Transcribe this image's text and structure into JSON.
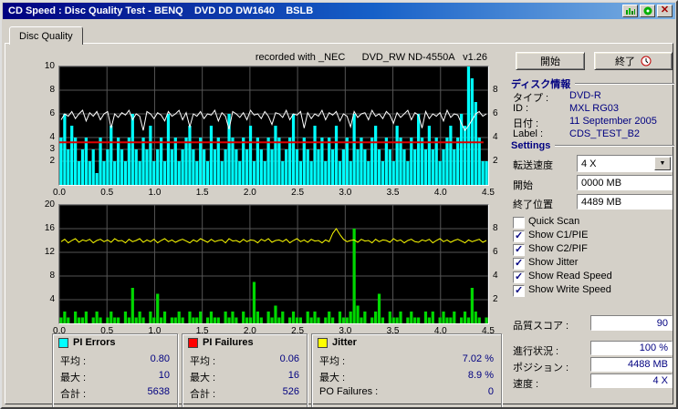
{
  "window": {
    "title": "CD Speed : Disc Quality Test - BENQ    DVD DD DW1640    BSLB"
  },
  "tab": {
    "label": "Disc Quality"
  },
  "recorded_label": "recorded with _NEC      DVD_RW ND-4550A   v1.26",
  "buttons": {
    "start": "開始",
    "exit": "終了"
  },
  "disc_info": {
    "header": "ディスク情報",
    "rows": [
      {
        "label": "タイプ :",
        "value": "DVD-R"
      },
      {
        "label": "ID :",
        "value": "MXL RG03"
      },
      {
        "label": "日付 :",
        "value": "11 September 2005"
      },
      {
        "label": "Label :",
        "value": "CDS_TEST_B2"
      }
    ]
  },
  "settings": {
    "header": "Settings",
    "speed_label": "転送速度",
    "speed_value": "4 X",
    "start_label": "開始",
    "start_value": "0000 MB",
    "end_label": "終了位置",
    "end_value": "4489 MB",
    "checkboxes": [
      {
        "label": "Quick Scan",
        "checked": false
      },
      {
        "label": "Show C1/PIE",
        "checked": true
      },
      {
        "label": "Show C2/PIF",
        "checked": true
      },
      {
        "label": "Show Jitter",
        "checked": true
      },
      {
        "label": "Show Read Speed",
        "checked": true
      },
      {
        "label": "Show Write Speed",
        "checked": true
      }
    ]
  },
  "quality": {
    "label": "品質スコア :",
    "value": "90"
  },
  "progress": {
    "rows": [
      {
        "label": "進行状況 :",
        "value": "100 %"
      },
      {
        "label": "ポジション :",
        "value": "4488 MB"
      },
      {
        "label": "速度 :",
        "value": "4 X"
      }
    ]
  },
  "stats": {
    "pi_errors": {
      "title": "PI Errors",
      "color": "#00ffff",
      "rows": [
        {
          "label": "平均 :",
          "value": "0.80"
        },
        {
          "label": "最大 :",
          "value": "10"
        },
        {
          "label": "合計 :",
          "value": "5638"
        }
      ]
    },
    "pi_failures": {
      "title": "PI Failures",
      "color": "#ff0000",
      "rows": [
        {
          "label": "平均 :",
          "value": "0.06"
        },
        {
          "label": "最大 :",
          "value": "16"
        },
        {
          "label": "合計 :",
          "value": "526"
        }
      ]
    },
    "jitter": {
      "title": "Jitter",
      "color": "#ffff00",
      "rows": [
        {
          "label": "平均 :",
          "value": "7.02 %"
        },
        {
          "label": "最大 :",
          "value": "8.9 %"
        },
        {
          "label": "PO Failures :",
          "value": "0"
        }
      ]
    }
  },
  "chart_data": [
    {
      "name": "pi-errors",
      "type": "bar",
      "x_range": [
        0,
        4.5
      ],
      "y_range": [
        0,
        10
      ],
      "x_ticks": [
        {
          "label": "0.0",
          "at": 0
        },
        {
          "label": "0.5",
          "at": 0.5
        },
        {
          "label": "1.0",
          "at": 1
        },
        {
          "label": "1.5",
          "at": 1.5
        },
        {
          "label": "2.0",
          "at": 2
        },
        {
          "label": "2.5",
          "at": 2.5
        },
        {
          "label": "3.0",
          "at": 3
        },
        {
          "label": "3.5",
          "at": 3.5
        },
        {
          "label": "4.0",
          "at": 4
        },
        {
          "label": "4.5",
          "at": 4.5
        }
      ],
      "y_ticks_left": [
        {
          "label": "10",
          "at": 10
        },
        {
          "label": "8",
          "at": 8
        },
        {
          "label": "6",
          "at": 6
        },
        {
          "label": "4",
          "at": 4
        },
        {
          "label": "3",
          "at": 3
        },
        {
          "label": "2",
          "at": 2
        }
      ],
      "y_ticks_right": [
        {
          "label": "8",
          "at": 8
        },
        {
          "label": "6",
          "at": 6
        },
        {
          "label": "4",
          "at": 4
        },
        {
          "label": "2",
          "at": 2
        }
      ],
      "series": [
        {
          "name": "PI Errors",
          "kind": "bar",
          "color": "#00ffff",
          "values": [
            4,
            6,
            3,
            5,
            4,
            2,
            3,
            4,
            2,
            3,
            1,
            4,
            2,
            3,
            5,
            2,
            4,
            3,
            2,
            4,
            6,
            3,
            2,
            4,
            3,
            5,
            2,
            3,
            4,
            2,
            6,
            3,
            4,
            2,
            3,
            4,
            5,
            3,
            2,
            4,
            3,
            2,
            5,
            3,
            4,
            2,
            3,
            6,
            4,
            3,
            2,
            4,
            3,
            5,
            2,
            4,
            3,
            2,
            4,
            3,
            5,
            4,
            2,
            3,
            4,
            6,
            3,
            2,
            4,
            3,
            2,
            5,
            3,
            4,
            2,
            4,
            3,
            5,
            2,
            3,
            4,
            2,
            6,
            3,
            4,
            3,
            2,
            4,
            5,
            3,
            2,
            4,
            3,
            2,
            5,
            4,
            3,
            2,
            4,
            3,
            6,
            4,
            3,
            5,
            3,
            4,
            2,
            3,
            4,
            5,
            3,
            4,
            6,
            5,
            10,
            9,
            7,
            4,
            2,
            2
          ]
        },
        {
          "name": "Read Speed",
          "kind": "line",
          "color": "#ffffff",
          "values": [
            5.5,
            6.0,
            5.8,
            6.2,
            5.6,
            6.0,
            6.3,
            5.4,
            6.1,
            5.8,
            6.2,
            5.5,
            6.0,
            6.2,
            4.8,
            6.0,
            5.7,
            6.1,
            5.9,
            6.3,
            5.5,
            6.0,
            5.8,
            4.6,
            6.2,
            6.0,
            5.6,
            6.1,
            5.9,
            5.4,
            6.2,
            5.8,
            6.0,
            6.3,
            5.5,
            6.1,
            4.9,
            6.0,
            5.8,
            6.2,
            5.6,
            6.0,
            5.9,
            6.3,
            5.4,
            6.1,
            5.8,
            4.7,
            6.2,
            6.0,
            5.7,
            6.1,
            5.5,
            6.3,
            5.9,
            6.0,
            5.6,
            6.2,
            5.8,
            5.1,
            6.1,
            6.0,
            5.7,
            6.3,
            5.5,
            6.0,
            5.9,
            6.2,
            4.8,
            6.1,
            5.6,
            6.0,
            5.8,
            6.3,
            5.5,
            6.1,
            5.9,
            6.2,
            5.4,
            6.0,
            5.8,
            4.9,
            6.2,
            5.7,
            6.0,
            6.1,
            5.5,
            6.3,
            5.8,
            6.0,
            5.6,
            6.2,
            5.9,
            5.2,
            6.1,
            5.7,
            6.0,
            6.3,
            5.5,
            6.1,
            5.9,
            4.8,
            6.2,
            5.6,
            6.0,
            5.8,
            6.1,
            5.4,
            6.3,
            5.7,
            6.0,
            5.9,
            5.2,
            4.6,
            5.0,
            5.5,
            6.0,
            6.2,
            5.8,
            6.0
          ]
        },
        {
          "name": "Write Speed",
          "kind": "hline",
          "color": "#e00000",
          "value": 3.6,
          "x_end": 4.45
        }
      ]
    },
    {
      "name": "pi-failures-jitter",
      "type": "bar",
      "x_range": [
        0,
        4.5
      ],
      "y_range": [
        0,
        20
      ],
      "x_ticks": [
        {
          "label": "0.0",
          "at": 0
        },
        {
          "label": "0.5",
          "at": 0.5
        },
        {
          "label": "1.0",
          "at": 1
        },
        {
          "label": "1.5",
          "at": 1.5
        },
        {
          "label": "2.0",
          "at": 2
        },
        {
          "label": "2.5",
          "at": 2.5
        },
        {
          "label": "3.0",
          "at": 3
        },
        {
          "label": "3.5",
          "at": 3.5
        },
        {
          "label": "4.0",
          "at": 4
        },
        {
          "label": "4.5",
          "at": 4.5
        }
      ],
      "y_ticks_left": [
        {
          "label": "20",
          "at": 20
        },
        {
          "label": "16",
          "at": 16
        },
        {
          "label": "12",
          "at": 12
        },
        {
          "label": "8",
          "at": 8
        },
        {
          "label": "4",
          "at": 4
        }
      ],
      "y_ticks_right": [
        {
          "label": "8",
          "at": 16
        },
        {
          "label": "6",
          "at": 12
        },
        {
          "label": "4",
          "at": 8
        },
        {
          "label": "2",
          "at": 4
        }
      ],
      "series": [
        {
          "name": "PI Failures",
          "kind": "bar",
          "color": "#00d800",
          "values": [
            1,
            2,
            1,
            0,
            2,
            1,
            1,
            2,
            0,
            1,
            2,
            1,
            0,
            1,
            2,
            1,
            1,
            0,
            2,
            1,
            6,
            1,
            2,
            1,
            0,
            2,
            1,
            5,
            1,
            2,
            0,
            1,
            1,
            2,
            1,
            0,
            2,
            1,
            1,
            2,
            0,
            1,
            2,
            1,
            1,
            0,
            2,
            1,
            2,
            1,
            0,
            2,
            1,
            1,
            7,
            2,
            1,
            0,
            2,
            1,
            3,
            1,
            2,
            0,
            1,
            2,
            1,
            1,
            0,
            2,
            1,
            2,
            1,
            0,
            1,
            2,
            1,
            0,
            2,
            1,
            1,
            2,
            16,
            3,
            1,
            2,
            0,
            1,
            2,
            5,
            1,
            0,
            2,
            1,
            1,
            2,
            0,
            1,
            2,
            1,
            1,
            0,
            2,
            1,
            2,
            0,
            1,
            2,
            1,
            1,
            2,
            0,
            1,
            2,
            1,
            6,
            2,
            1,
            0,
            1
          ]
        },
        {
          "name": "Jitter",
          "kind": "line",
          "color": "#ffff00",
          "values": [
            13.8,
            14.2,
            13.6,
            14.0,
            14.3,
            13.7,
            14.1,
            13.9,
            14.2,
            13.6,
            14.0,
            14.2,
            13.8,
            14.1,
            13.7,
            14.3,
            13.9,
            14.0,
            13.6,
            14.2,
            13.8,
            14.0,
            14.3,
            13.7,
            14.1,
            13.8,
            14.2,
            13.6,
            14.0,
            14.3,
            13.8,
            14.1,
            13.7,
            14.0,
            14.2,
            13.9,
            13.6,
            14.1,
            13.8,
            14.3,
            14.0,
            13.7,
            14.2,
            13.8,
            14.0,
            14.1,
            13.6,
            14.3,
            13.9,
            14.0,
            13.7,
            14.2,
            13.8,
            14.1,
            14.0,
            13.6,
            14.2,
            13.9,
            14.3,
            13.7,
            14.0,
            14.1,
            13.8,
            14.2,
            13.6,
            14.0,
            14.3,
            13.8,
            14.1,
            13.7,
            14.2,
            13.9,
            14.0,
            13.6,
            14.1,
            13.8,
            15.2,
            16.0,
            15.0,
            14.2,
            13.8,
            14.0,
            14.1,
            13.7,
            14.2,
            13.9,
            14.0,
            13.6,
            14.2,
            13.8,
            14.1,
            14.0,
            13.7,
            14.3,
            13.9,
            14.1,
            13.6,
            14.0,
            14.2,
            13.8,
            13.7,
            14.1,
            13.9,
            14.2,
            13.6,
            14.0,
            14.3,
            13.8,
            14.1,
            13.7,
            14.0,
            14.2,
            13.9,
            13.6,
            14.1,
            13.8,
            14.0,
            14.2,
            13.7,
            14.0
          ]
        }
      ]
    }
  ]
}
